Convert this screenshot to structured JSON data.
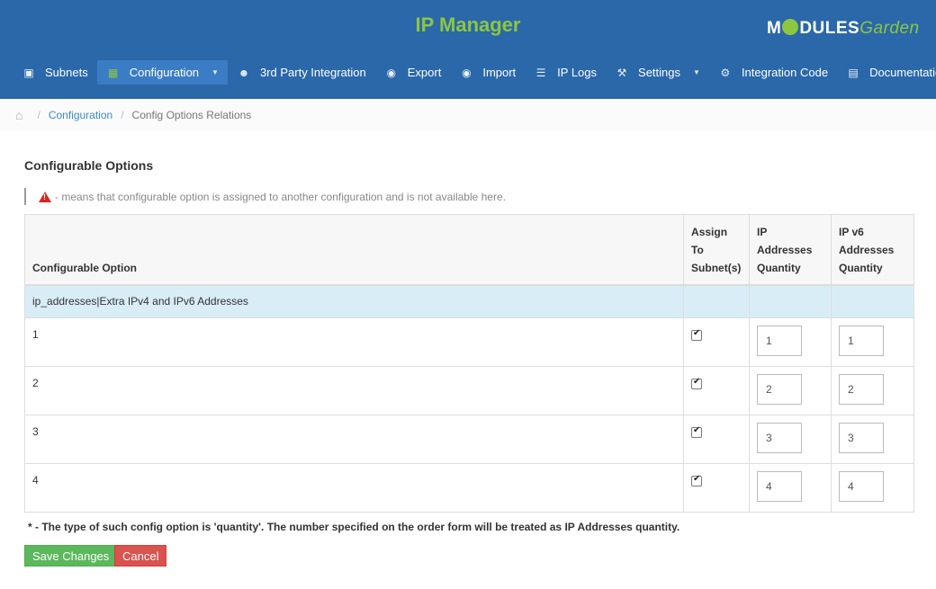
{
  "header": {
    "app_title": "IP Manager",
    "logo_left": "M",
    "logo_mid": "DULES",
    "logo_right": "Garden"
  },
  "nav": [
    {
      "label": "Subnets",
      "icon": "briefcase-icon",
      "glyph": "▣"
    },
    {
      "label": "Configuration",
      "icon": "grid-icon",
      "glyph": "▦",
      "active": true,
      "caret": "▼"
    },
    {
      "label": "3rd Party Integration",
      "icon": "users-icon",
      "glyph": "☻"
    },
    {
      "label": "Export",
      "icon": "export-icon",
      "glyph": "◉"
    },
    {
      "label": "Import",
      "icon": "import-icon",
      "glyph": "◉"
    },
    {
      "label": "IP Logs",
      "icon": "list-icon",
      "glyph": "☰"
    },
    {
      "label": "Settings",
      "icon": "wrench-icon",
      "glyph": "⚒",
      "caret": "▼"
    },
    {
      "label": "Integration Code",
      "icon": "gears-icon",
      "glyph": "⚙"
    },
    {
      "label": "Documentation",
      "icon": "book-icon",
      "glyph": "▤"
    }
  ],
  "breadcrumb": {
    "home_glyph": "⌂",
    "sep": "/",
    "link": "Configuration",
    "current": "Config Options Relations"
  },
  "section_title": "Configurable Options",
  "note": "- means that configurable option is assigned to another configuration and is not available here.",
  "table": {
    "headers": {
      "option": "Configurable Option",
      "assign": "Assign To Subnet(s)",
      "ip_qty": "IP Addresses Quantity",
      "ipv6_qty": "IP v6 Addresses Quantity"
    },
    "group": "ip_addresses|Extra IPv4 and IPv6 Addresses",
    "rows": [
      {
        "option": "1",
        "assigned": true,
        "ip_qty": "1",
        "ipv6_qty": "1"
      },
      {
        "option": "2",
        "assigned": true,
        "ip_qty": "2",
        "ipv6_qty": "2"
      },
      {
        "option": "3",
        "assigned": true,
        "ip_qty": "3",
        "ipv6_qty": "3"
      },
      {
        "option": "4",
        "assigned": true,
        "ip_qty": "4",
        "ipv6_qty": "4"
      }
    ]
  },
  "footnote": "* - The type of such config option is 'quantity'. The number specified on the order form will be treated as IP Addresses quantity.",
  "buttons": {
    "save": "Save Changes",
    "cancel": "Cancel"
  }
}
